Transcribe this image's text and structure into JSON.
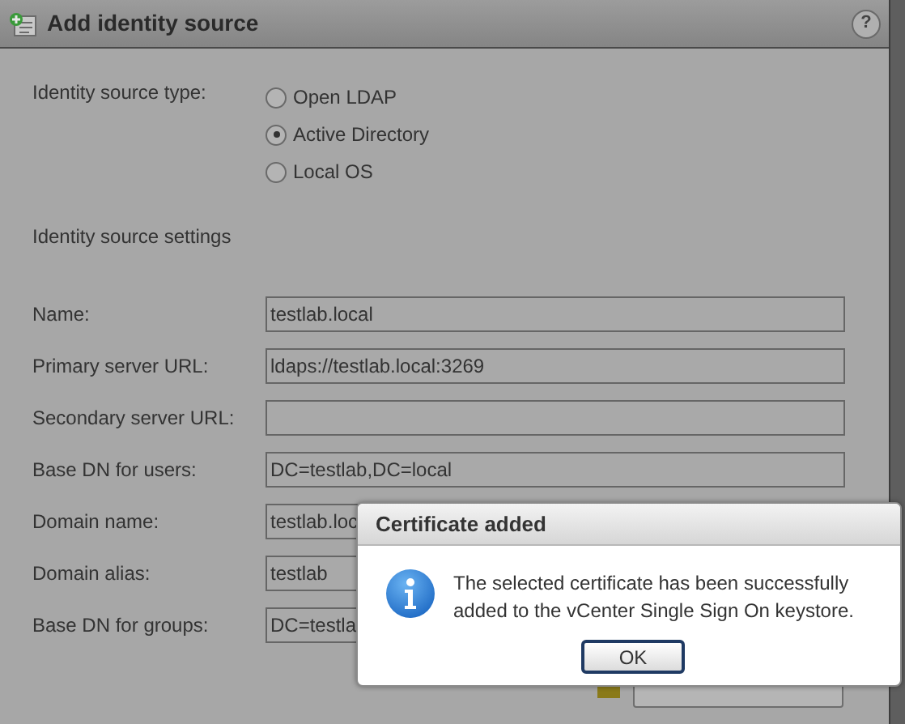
{
  "window": {
    "title": "Add identity source",
    "help": "?"
  },
  "source_type": {
    "label": "Identity source type:",
    "options": [
      {
        "label": "Open LDAP",
        "selected": false
      },
      {
        "label": "Active Directory",
        "selected": true
      },
      {
        "label": "Local OS",
        "selected": false
      }
    ]
  },
  "settings_heading": "Identity source settings",
  "fields": [
    {
      "label": "Name:",
      "value": "testlab.local"
    },
    {
      "label": "Primary server URL:",
      "value": "ldaps://testlab.local:3269"
    },
    {
      "label": "Secondary server URL:"
    },
    {
      "label": "Base DN for users:",
      "value": "DC=testlab,DC=local"
    },
    {
      "label": "Domain name:",
      "value": "testlab.loc"
    },
    {
      "label": "Domain alias:",
      "value": "testlab"
    },
    {
      "label": "Base DN for groups:",
      "value": "DC=testla"
    }
  ],
  "dialog": {
    "title": "Certificate added",
    "message": "The selected certificate has been successfully added to the vCenter Single Sign On keystore.",
    "ok": "OK"
  }
}
